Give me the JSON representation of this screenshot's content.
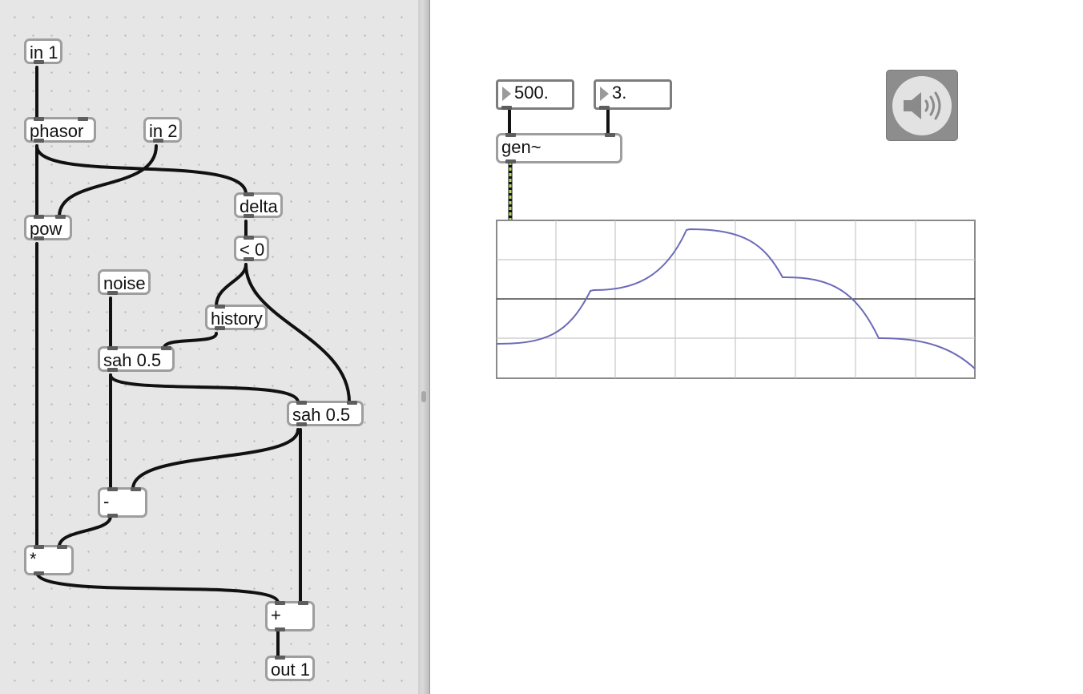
{
  "gen_patcher": {
    "objects": {
      "in1": "in 1",
      "phasor": "phasor",
      "in2": "in 2",
      "pow": "pow",
      "delta": "delta",
      "lt0": "< 0",
      "noise": "noise",
      "history": "history",
      "sah1": "sah 0.5",
      "sah2": "sah 0.5",
      "minus": "-",
      "mul": "*",
      "plus": "+",
      "out1": "out 1"
    }
  },
  "main_patcher": {
    "number_box_1": "500.",
    "number_box_2": "3.",
    "gen_object": "gen~",
    "dac_icon": "speaker-volume-icon",
    "colors": {
      "signal_cable": "#b8d86b",
      "scope_trace": "#6b6bb8",
      "scope_grid": "#c8c8c8",
      "pane_background": "#e6e6e6"
    }
  }
}
